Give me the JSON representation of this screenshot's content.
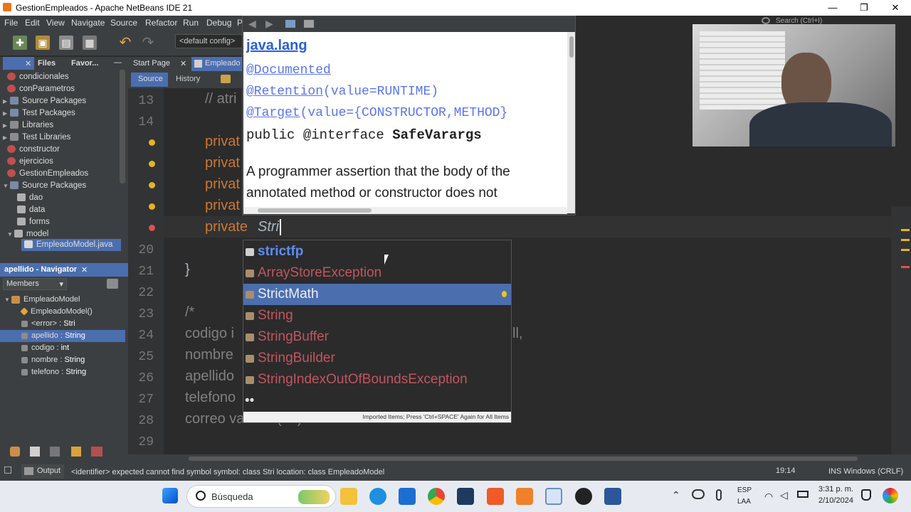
{
  "window": {
    "title": "GestionEmpleados - Apache NetBeans IDE 21",
    "min": "—",
    "max": "❐",
    "close": "✕",
    "search": "Search (Ctrl+I)"
  },
  "menu": [
    "File",
    "Edit",
    "View",
    "Navigate",
    "Source",
    "Refactor",
    "Run",
    "Debug",
    "P"
  ],
  "toolbar": {
    "config": "<default config>"
  },
  "left_tabs": {
    "files": "Files",
    "favorites": "Favor...",
    "close": "✕",
    "minimize": "—"
  },
  "project_tree": [
    {
      "label": "condicionales",
      "level": 0,
      "type": "project"
    },
    {
      "label": "conParametros",
      "level": 0,
      "type": "project"
    },
    {
      "label": "Source Packages",
      "level": 1,
      "type": "folder"
    },
    {
      "label": "Test Packages",
      "level": 1,
      "type": "folder"
    },
    {
      "label": "Libraries",
      "level": 1,
      "type": "folder"
    },
    {
      "label": "Test Libraries",
      "level": 1,
      "type": "folder"
    },
    {
      "label": "constructor",
      "level": 0,
      "type": "project"
    },
    {
      "label": "ejercicios",
      "level": 0,
      "type": "project"
    },
    {
      "label": "GestionEmpleados",
      "level": 0,
      "type": "project"
    },
    {
      "label": "Source Packages",
      "level": 1,
      "type": "folder"
    },
    {
      "label": "dao",
      "level": 2,
      "type": "package"
    },
    {
      "label": "data",
      "level": 2,
      "type": "package"
    },
    {
      "label": "forms",
      "level": 2,
      "type": "package"
    },
    {
      "label": "model",
      "level": 2,
      "type": "package"
    },
    {
      "label": "EmpleadoModel.java",
      "level": 3,
      "type": "file",
      "selected": true
    }
  ],
  "navigator": {
    "title": "apellido - Navigator",
    "close": "✕",
    "filter": "Members",
    "items": [
      {
        "name": "EmpleadoModel",
        "type": "",
        "level": 0
      },
      {
        "name": "EmpleadoModel()",
        "type": "",
        "level": 1
      },
      {
        "name": "<error>",
        "type": "Stri",
        "level": 1
      },
      {
        "name": "apellido",
        "type": "String",
        "level": 1,
        "selected": true
      },
      {
        "name": "codigo",
        "type": "int",
        "level": 1
      },
      {
        "name": "nombre",
        "type": "String",
        "level": 1
      },
      {
        "name": "telefono",
        "type": "String",
        "level": 1
      }
    ]
  },
  "editor": {
    "tabs": [
      {
        "label": "Start Page",
        "close": "✕"
      },
      {
        "label": "Empleado",
        "active": true
      }
    ],
    "subtabs": [
      "Source",
      "History"
    ],
    "lines": [
      {
        "num": "13",
        "text": "// atri",
        "cls": "comment",
        "indent": 58
      },
      {
        "num": "14",
        "text": "",
        "cls": "",
        "indent": 58
      },
      {
        "num": "",
        "text": "privat",
        "cls": "kw",
        "indent": 58
      },
      {
        "num": "",
        "text": "privat",
        "cls": "kw",
        "indent": 58
      },
      {
        "num": "",
        "text": "privat",
        "cls": "kw",
        "indent": 58
      },
      {
        "num": "",
        "text": "privat",
        "cls": "kw",
        "indent": 58
      },
      {
        "num": "",
        "text": "private",
        "cls": "kw",
        "indent": 58,
        "typed": "Stri"
      },
      {
        "num": "20",
        "text": "",
        "cls": "",
        "indent": 30
      },
      {
        "num": "21",
        "text": "}",
        "cls": "plain",
        "indent": 30
      },
      {
        "num": "22",
        "text": "",
        "cls": "",
        "indent": 30
      },
      {
        "num": "23",
        "text": "/*",
        "cls": "comment",
        "indent": 30
      },
      {
        "num": "24",
        "text": "codigo i",
        "cls": "comment",
        "indent": 30
      },
      {
        "num": "25",
        "text": "nombre",
        "cls": "comment",
        "indent": 30
      },
      {
        "num": "26",
        "text": "apellido",
        "cls": "comment",
        "indent": 30
      },
      {
        "num": "27",
        "text": "telefono",
        "cls": "comment",
        "indent": 30
      },
      {
        "num": "28",
        "text": "correo varchar(50) not null",
        "cls": "comment",
        "indent": 30
      },
      {
        "num": "29",
        "text": "",
        "cls": "",
        "indent": 30
      }
    ],
    "hidden_suffix_24": "ll,"
  },
  "javadoc": {
    "package": "java.lang",
    "ann1": "@Documented",
    "ann2_name": "@Retention",
    "ann2_args": "(value=RUNTIME)",
    "ann3_name": "@Target",
    "ann3_args": "(value={CONSTRUCTOR,METHOD}",
    "decl_prefix": "public @interface ",
    "decl_name": "SafeVarargs",
    "desc1": "A programmer assertion that the body of the",
    "desc2": "annotated method or constructor does not"
  },
  "completion": {
    "items": [
      {
        "label": "strictfp",
        "kind": "keyword"
      },
      {
        "label": "ArrayStoreException",
        "kind": "class"
      },
      {
        "label": "StrictMath",
        "kind": "class",
        "selected": true
      },
      {
        "label": "String",
        "kind": "class"
      },
      {
        "label": "StringBuffer",
        "kind": "class"
      },
      {
        "label": "StringBuilder",
        "kind": "class"
      },
      {
        "label": "StringIndexOutOfBoundsException",
        "kind": "class"
      },
      {
        "label": "••",
        "kind": "more"
      }
    ],
    "footer": "Imported Items; Press 'Ctrl+SPACE' Again for All Items"
  },
  "status": {
    "output_tab": "Output",
    "message": "<identifier> expected  cannot find symbol  symbol:  class Stri  location: class EmpleadoModel",
    "position": "19:14",
    "mode": "INS Windows (CRLF)"
  },
  "taskbar": {
    "search": "Búsqueda",
    "lang1": "ESP",
    "lang2": "LAA",
    "time": "3:31 p. m.",
    "date": "2/10/2024"
  },
  "colors": {
    "accent": "#4b6eaf",
    "keyword": "#cc7832",
    "comment": "#808080",
    "error": "#c2555f",
    "link": "#5a75f0"
  }
}
